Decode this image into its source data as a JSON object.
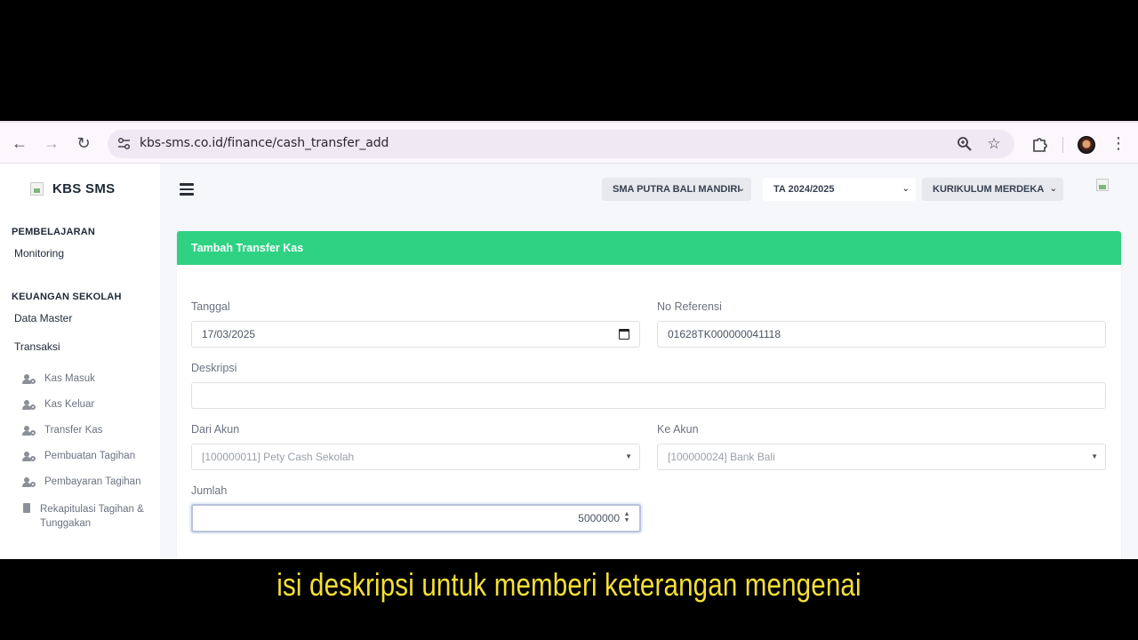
{
  "browser": {
    "url": "kbs-sms.co.id/finance/cash_transfer_add",
    "icons": [
      "back-icon",
      "forward-icon",
      "reload-icon",
      "site-settings-icon",
      "zoom-icon",
      "star-icon",
      "extensions-icon",
      "profile-avatar",
      "menu-kebab-icon"
    ]
  },
  "sidebar": {
    "brand": "KBS SMS",
    "sections": [
      {
        "heading": "PEMBELAJARAN"
      },
      {
        "heading": "KEUANGAN SEKOLAH"
      }
    ],
    "items": {
      "monitoring": "Monitoring",
      "data_master": "Data Master",
      "transaksi": "Transaksi"
    },
    "sub_items": [
      {
        "label": "Kas Masuk",
        "icon": "user-gear-icon"
      },
      {
        "label": "Kas Keluar",
        "icon": "user-gear-icon"
      },
      {
        "label": "Transfer Kas",
        "icon": "user-gear-icon"
      },
      {
        "label": "Pembuatan Tagihan",
        "icon": "user-gear-icon"
      },
      {
        "label": "Pembayaran Tagihan",
        "icon": "user-gear-icon"
      },
      {
        "label": "Rekapitulasi Tagihan & Tunggakan",
        "icon": "book-icon"
      }
    ]
  },
  "topbar": {
    "school": "SMA PUTRA BALI MANDIRI",
    "year": "TA 2024/2025",
    "curriculum": "KURIKULUM MERDEKA"
  },
  "form": {
    "title": "Tambah Transfer Kas",
    "tanggal_label": "Tanggal",
    "tanggal_value": "17/03/2025",
    "no_ref_label": "No Referensi",
    "no_ref_value": "01628TK000000041118",
    "deskripsi_label": "Deskripsi",
    "deskripsi_value": "",
    "dari_akun_label": "Dari Akun",
    "dari_akun_value": "[100000011] Pety Cash Sekolah",
    "ke_akun_label": "Ke Akun",
    "ke_akun_value": "[100000024] Bank Bali",
    "jumlah_label": "Jumlah",
    "jumlah_value": "5000000"
  },
  "subtitle": "isi deskripsi untuk memberi keterangan mengenai"
}
